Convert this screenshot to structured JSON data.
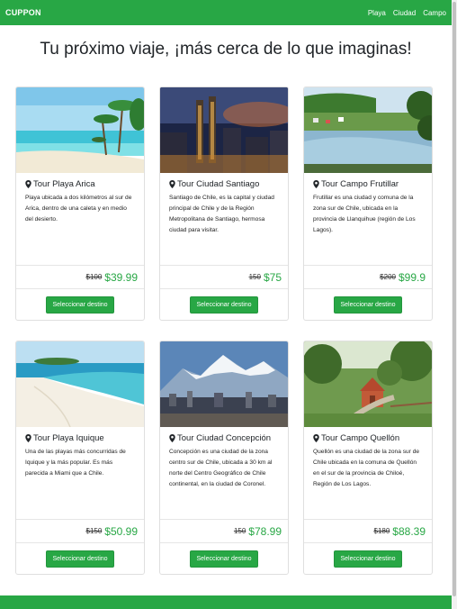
{
  "navbar": {
    "brand": "CUPPON",
    "links": [
      "Playa",
      "Ciudad",
      "Campo"
    ]
  },
  "heading": "Tu próximo viaje, ¡más cerca de lo que imaginas!",
  "button_label": "Seleccionar destino",
  "cards": [
    {
      "title": "Tour Playa Arica",
      "description": "Playa ubicada a dos kilómetros al sur de Arica, dentro de una caleta y en medio del desierto.",
      "old_price": "$100",
      "new_price": "$39.99"
    },
    {
      "title": "Tour Ciudad Santiago",
      "description": "Santiago de Chile, es la capital y ciudad principal de Chile y de la Región Metropolitana de Santiago, hermosa ciudad para visitar.",
      "old_price": "150",
      "new_price": "$75"
    },
    {
      "title": "Tour Campo Frutillar",
      "description": "Frutillar es una ciudad y comuna de la zona sur de Chile, ubicada en la provincia de Llanquihue (región de Los Lagos).",
      "old_price": "$200",
      "new_price": "$99.9"
    },
    {
      "title": "Tour Playa Iquique",
      "description": "Una de las playas más concurridas de Iquique y la más popular. Es más parecida a Miami que a Chile.",
      "old_price": "$150",
      "new_price": "$50.99"
    },
    {
      "title": "Tour Ciudad Concepción",
      "description": "Concepción es una ciudad de la zona centro sur de Chile, ubicada a 30 km al norte del Centro Geográfico de Chile continental, en la ciudad de Coronel.",
      "old_price": "150",
      "new_price": "$78.99"
    },
    {
      "title": "Tour Campo Quellón",
      "description": "Quellón es una ciudad de la zona sur de Chile ubicada en la comuna de Quellón en el sur de la provincia de Chiloé, Región de Los Lagos.",
      "old_price": "$180",
      "new_price": "$88.39"
    }
  ],
  "colors": {
    "brand_green": "#28a745"
  },
  "icons": {
    "card_title_icon": "map-marker-icon"
  }
}
